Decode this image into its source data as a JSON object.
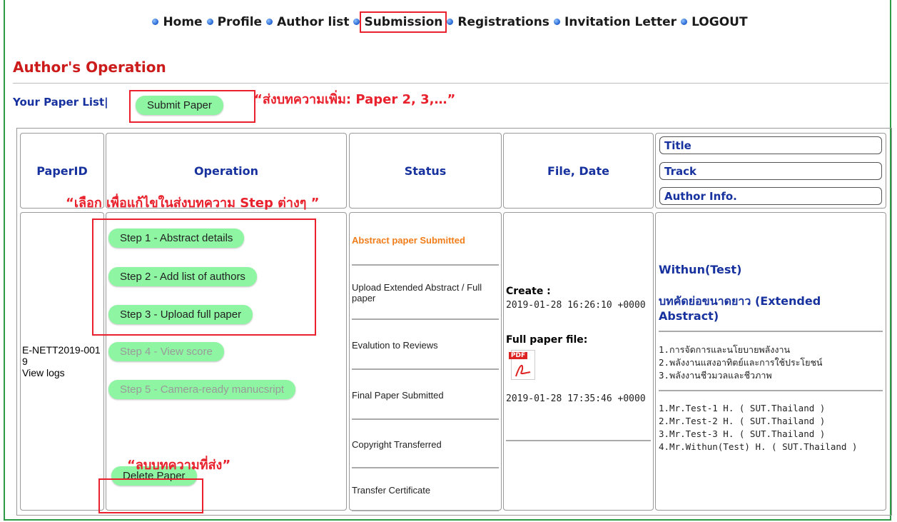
{
  "nav": {
    "items": [
      "Home",
      "Profile",
      "Author list",
      "Submission",
      "Registrations",
      "Invitation Letter",
      "LOGOUT"
    ]
  },
  "page": {
    "section_title": "Author's Operation",
    "paper_list_label": "Your Paper List|",
    "submit_button": "Submit Paper"
  },
  "annotations": {
    "submit_more": "“ส่งบทความเพิ่ม: Paper 2, 3,…”",
    "select_edit": "“เลือก เพื่อแก้ไขในส่งบทความ Step ต่างๆ ”",
    "delete_sent": "“ลบบทความที่ส่ง”"
  },
  "table": {
    "headers": {
      "paper_id": "PaperID",
      "operation": "Operation",
      "status": "Status",
      "file_date": "File, Date",
      "title": "Title",
      "track": "Track",
      "author_info": "Author Info."
    },
    "row": {
      "paper_id": "E-NETT2019-0019",
      "view_logs": "View logs",
      "steps": [
        "Step 1 - Abstract details",
        "Step 2 - Add list of authors",
        "Step 3 - Upload full paper",
        "Step 4 - View score",
        "Step 5 -  Camera-ready manucsript"
      ],
      "delete_button": "Delete Paper",
      "status_items": [
        "Abstract paper Submitted",
        "Upload Extended Abstract / Full paper",
        "Evalution to Reviews",
        "Final Paper Submitted",
        "Copyright Transferred",
        "Transfer Certificate"
      ],
      "create_label": "Create :",
      "create_date": "2019-01-28 16:26:10 +0000",
      "full_paper_label": "Full paper file:",
      "pdf_icon_text": "PDF",
      "full_paper_date": "2019-01-28 17:35:46 +0000",
      "author_name": "Withun(Test)",
      "paper_title": "บทคัดย่อขนาดยาว (Extended Abstract)",
      "tracks": [
        "1.การจัดการและนโยบายพลังงาน",
        "2.พลังงานแสงอาทิตย์และการใช้ประโยชน์",
        "3.พลังงานชีวมวลและชีวภาพ"
      ],
      "authors": [
        "1.Mr.Test-1 H. ( SUT.Thailand )",
        "2.Mr.Test-2 H. ( SUT.Thailand )",
        "3.Mr.Test-3 H. ( SUT.Thailand )",
        "4.Mr.Withun(Test) H. ( SUT.Thailand )"
      ]
    }
  },
  "colors": {
    "accent_red": "#e8212c",
    "title_red": "#cc1b1b",
    "link_blue": "#17329e",
    "button_green": "#8ef5a3",
    "status_orange": "#f07d1a",
    "frame_green": "#2e9a47"
  }
}
